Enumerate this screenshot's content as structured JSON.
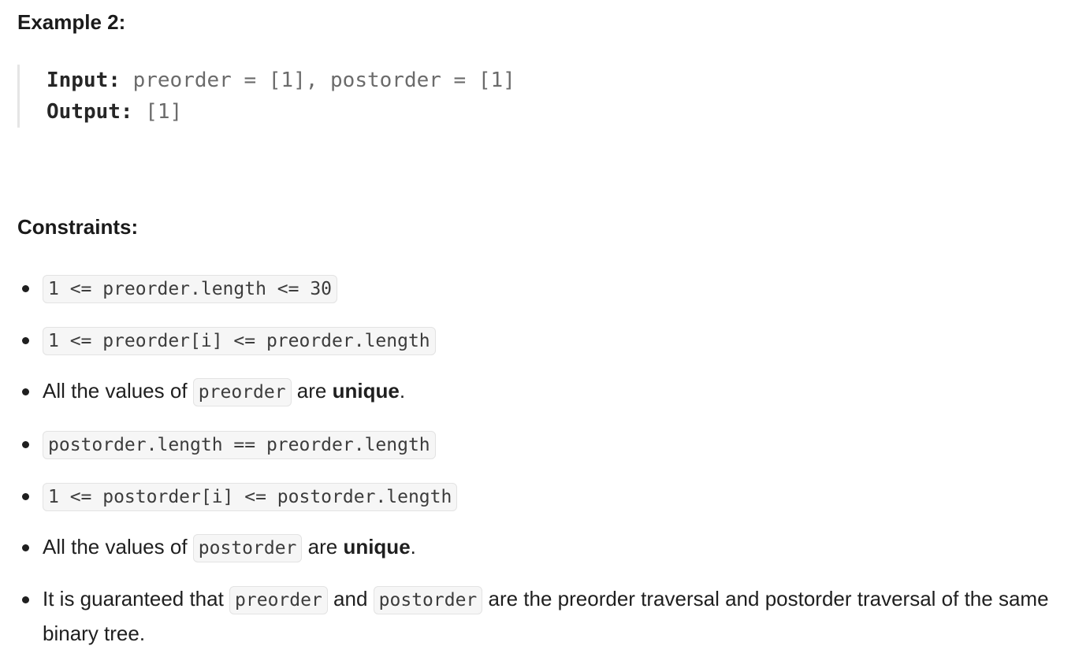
{
  "example": {
    "heading": "Example 2:",
    "input_label": "Input:",
    "input_value": " preorder = [1], postorder = [1]",
    "output_label": "Output:",
    "output_value": " [1]"
  },
  "constraints": {
    "heading": "Constraints:",
    "items": [
      {
        "code": "1 <= preorder.length <= 30"
      },
      {
        "code": "1 <= preorder[i] <= preorder.length"
      },
      {
        "text_before": "All the values of ",
        "code": "preorder",
        "text_mid": " are ",
        "strong": "unique",
        "text_after": "."
      },
      {
        "code": "postorder.length == preorder.length"
      },
      {
        "code": "1 <= postorder[i] <= postorder.length"
      },
      {
        "text_before": "All the values of ",
        "code": "postorder",
        "text_mid": " are ",
        "strong": "unique",
        "text_after": "."
      },
      {
        "text_before": "It is guaranteed that ",
        "code": "preorder",
        "text_mid": " and ",
        "code2": "postorder",
        "text_after": " are the preorder traversal and postorder traversal of the same binary tree."
      }
    ]
  }
}
